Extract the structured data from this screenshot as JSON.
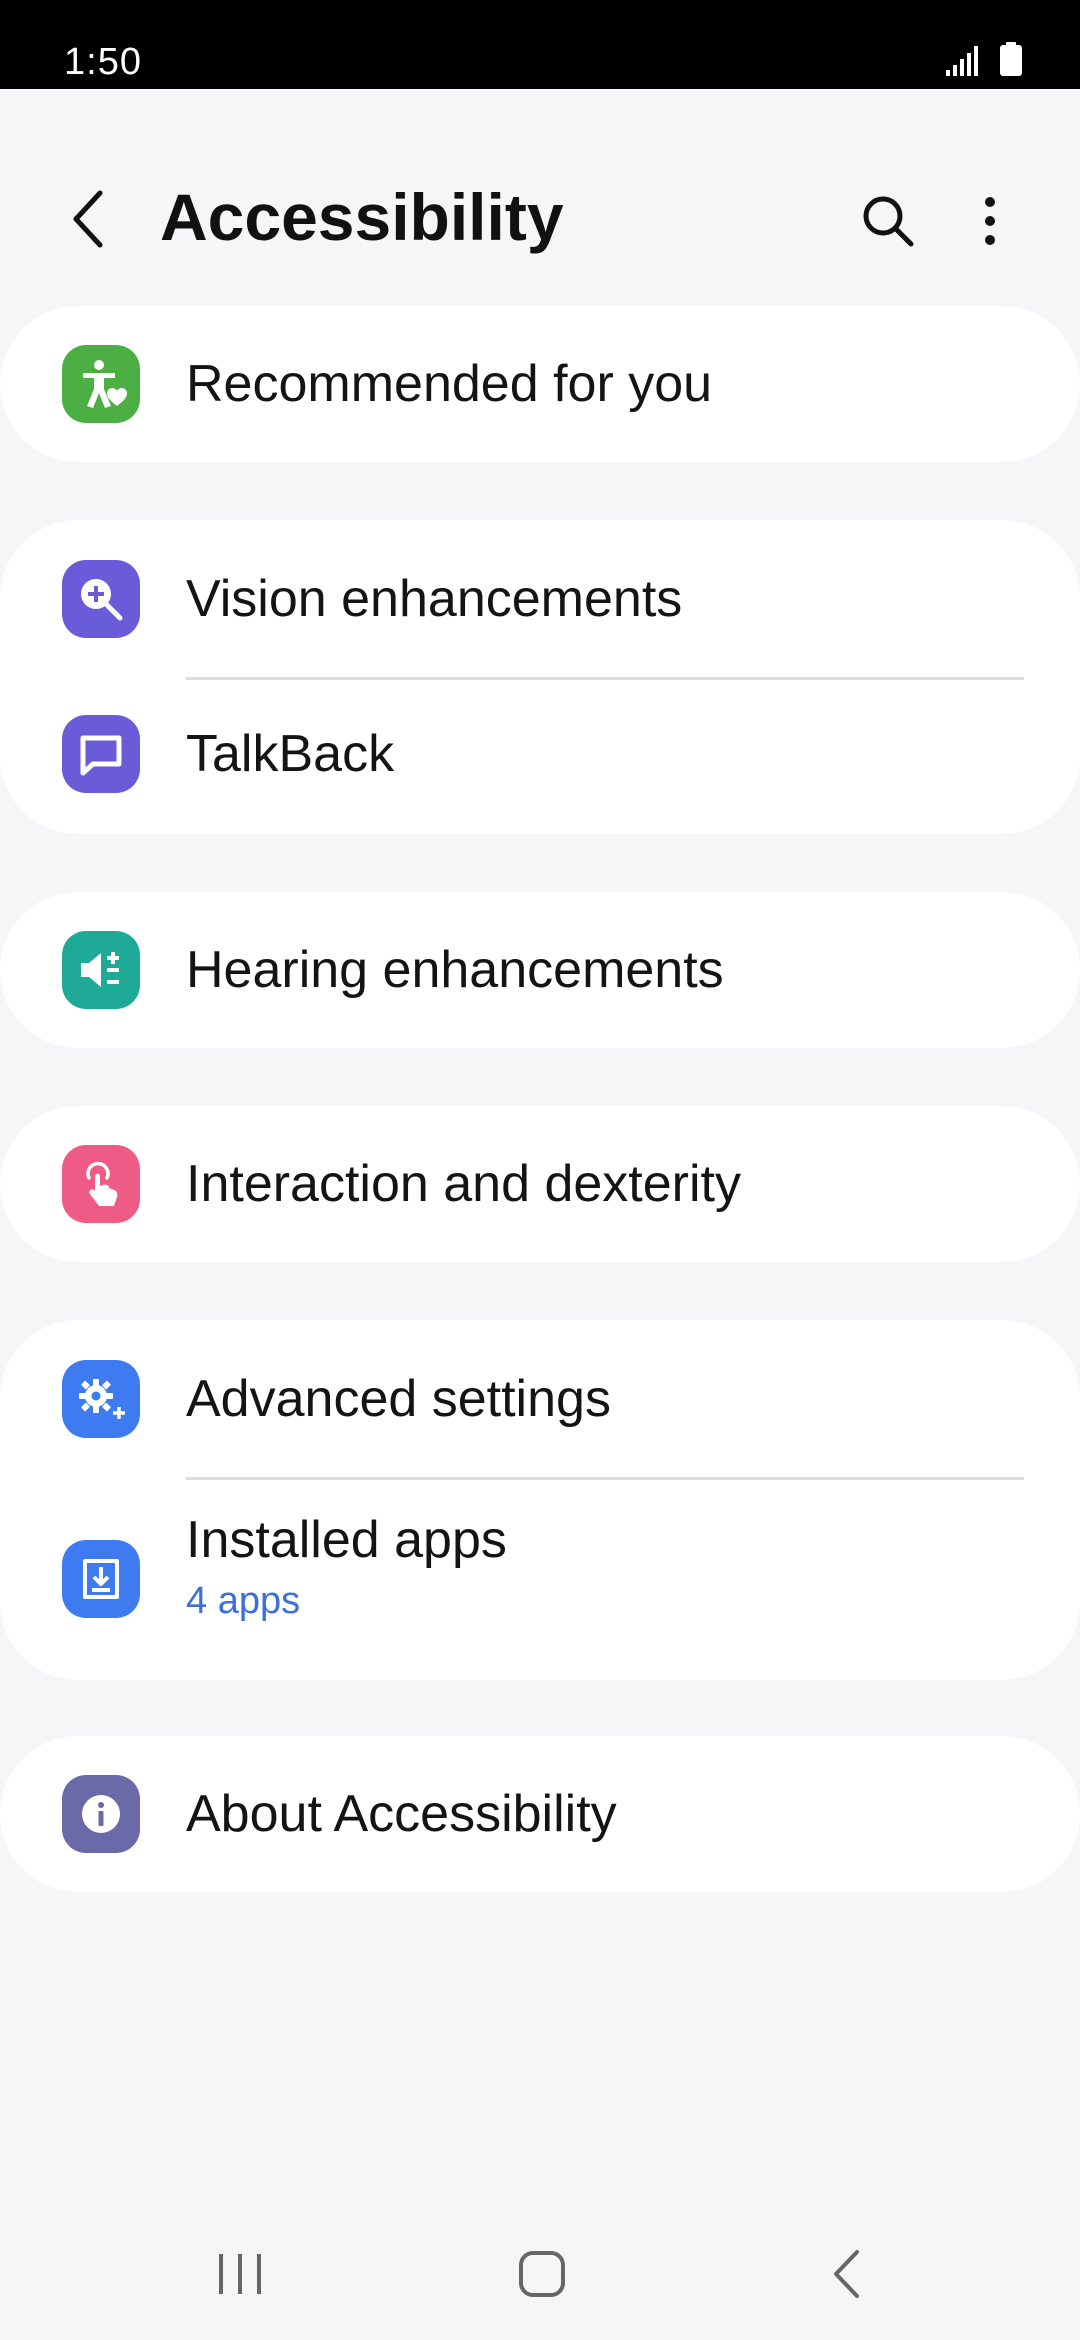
{
  "status_bar": {
    "time": "1:50"
  },
  "header": {
    "title": "Accessibility"
  },
  "items": [
    {
      "label": "Recommended for you",
      "icon": "accessibility-heart-icon",
      "color": "#4caf43"
    },
    {
      "label": "Vision enhancements",
      "icon": "magnifier-plus-icon",
      "color": "#6a5bd8"
    },
    {
      "label": "TalkBack",
      "icon": "speech-bubble-icon",
      "color": "#6a5bd8"
    },
    {
      "label": "Hearing enhancements",
      "icon": "speaker-plus-minus-icon",
      "color": "#1eaa96"
    },
    {
      "label": "Interaction and dexterity",
      "icon": "touch-hand-icon",
      "color": "#ee5b86"
    },
    {
      "label": "Advanced settings",
      "icon": "gear-plus-icon",
      "color": "#3e7af0"
    },
    {
      "label": "Installed apps",
      "sublabel": "4 apps",
      "icon": "download-icon",
      "color": "#3e7af0"
    },
    {
      "label": "About Accessibility",
      "icon": "info-icon",
      "color": "#6a6aa8"
    }
  ],
  "colors": {
    "background": "#f6f6f8",
    "card": "#ffffff",
    "accent_text": "#3e6fd8"
  }
}
